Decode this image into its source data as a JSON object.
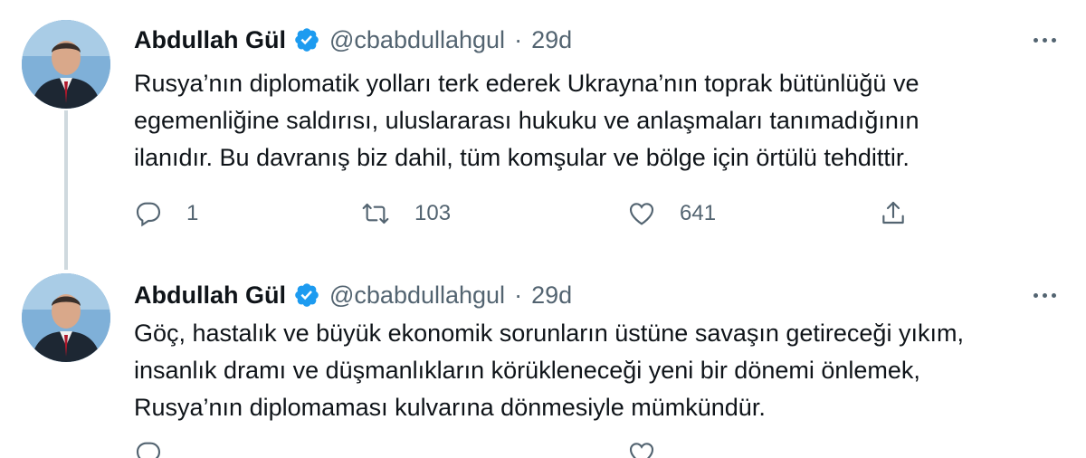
{
  "tweets": [
    {
      "name": "Abdullah Gül",
      "handle": "@cbabdullahgul",
      "separator": "·",
      "time": "29d",
      "lines": [
        "Rusya’nın diplomatik yolları terk ederek Ukrayna’nın toprak bütünlüğü ve",
        "egemenliğine saldırısı, uluslararası hukuku ve anlaşmaları tanımadığının",
        "ilanıdır. Bu davranış biz dahil, tüm komşular ve bölge için örtülü tehdittir."
      ],
      "replies": "1",
      "retweets": "103",
      "likes": "641"
    },
    {
      "name": "Abdullah Gül",
      "handle": "@cbabdullahgul",
      "separator": "·",
      "time": "29d",
      "lines": [
        "Göç, hastalık ve büyük ekonomik sorunların üstüne savaşın getireceği yıkım,",
        "insanlık dramı ve düşmanlıkların körükleneceği yeni bir dönemi önlemek,",
        "Rusya’nın diplomaması kulvarına dönmesiyle mümkündür."
      ]
    }
  ],
  "icons": {
    "verified": "verified-badge-icon",
    "more": "more-options-icon",
    "reply": "reply-icon",
    "retweet": "retweet-icon",
    "like": "like-icon",
    "share": "share-icon"
  },
  "colors": {
    "text": "#0f1419",
    "secondary": "#536471",
    "verified": "#1d9bf0",
    "thread_line": "#cfd9de"
  }
}
